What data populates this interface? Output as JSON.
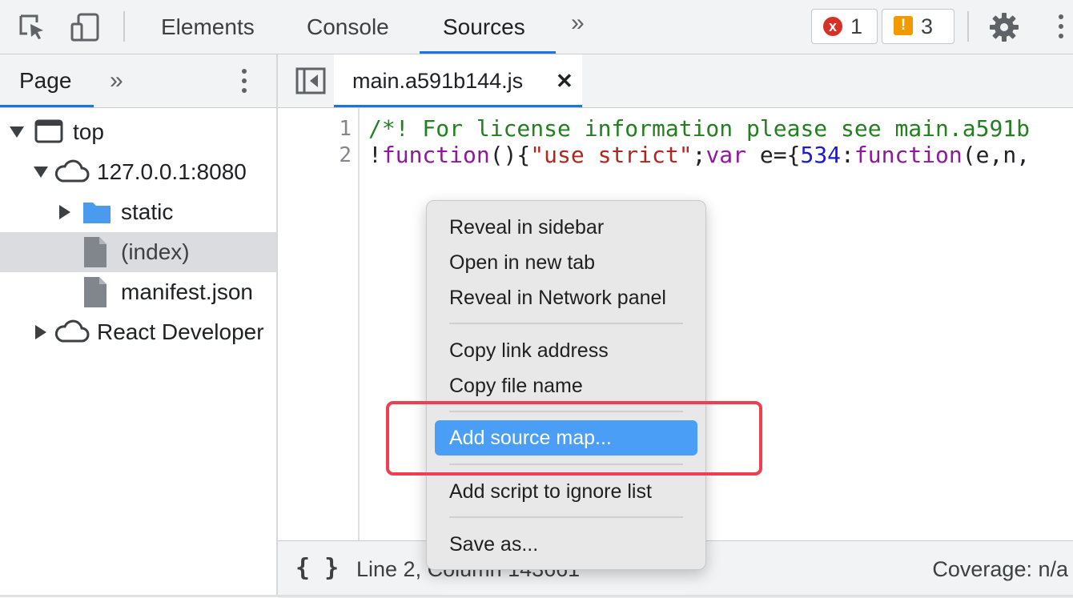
{
  "toolbar": {
    "tabs": [
      {
        "label": "Elements"
      },
      {
        "label": "Console"
      },
      {
        "label": "Sources",
        "active": true
      }
    ],
    "more_tabs_glyph": "»",
    "error_count": "1",
    "warning_count": "3",
    "error_icon": "x",
    "warning_icon": "!"
  },
  "sidebar": {
    "tab_label": "Page",
    "more_glyph": "»",
    "tree": [
      {
        "label": "top",
        "icon": "frame-icon",
        "expanded": true
      },
      {
        "label": "127.0.0.1:8080",
        "icon": "cloud-icon",
        "expanded": true
      },
      {
        "label": "static",
        "icon": "folder-icon",
        "expanded": false
      },
      {
        "label": "(index)",
        "icon": "file-icon",
        "selected": true
      },
      {
        "label": "manifest.json",
        "icon": "file-icon"
      },
      {
        "label": "React Developer",
        "icon": "cloud-icon",
        "expanded": false
      }
    ]
  },
  "editor": {
    "file_tab": "main.a591b144.js",
    "close_glyph": "✕",
    "lines": [
      {
        "number": "1"
      },
      {
        "number": "2"
      }
    ],
    "line1": "/*! For license information please see main.a591b",
    "line2": {
      "bang": "!",
      "kw_function": "function",
      "paren_open": "(){",
      "str": "\"use strict\"",
      "semi": ";",
      "kw_var": "var",
      "mid": " e={",
      "num": "534",
      "colon": ":",
      "kw_function2": "function",
      "tail": "(e,n,"
    },
    "status_position": "Line 2, Column 143661",
    "status_coverage": "Coverage: n/a",
    "pretty_print_glyph": "{ }"
  },
  "context_menu": {
    "groups": [
      [
        "Reveal in sidebar",
        "Open in new tab",
        "Reveal in Network panel"
      ],
      [
        "Copy link address",
        "Copy file name"
      ],
      [
        "Add source map..."
      ],
      [
        "Add script to ignore list"
      ],
      [
        "Save as..."
      ]
    ],
    "highlighted_item": "Add source map..."
  },
  "colors": {
    "accent": "#1a73e8",
    "menu_highlight": "#4a9ef5",
    "annotation_box": "#ef3e4f",
    "error": "#d93025",
    "warning": "#f29900"
  }
}
